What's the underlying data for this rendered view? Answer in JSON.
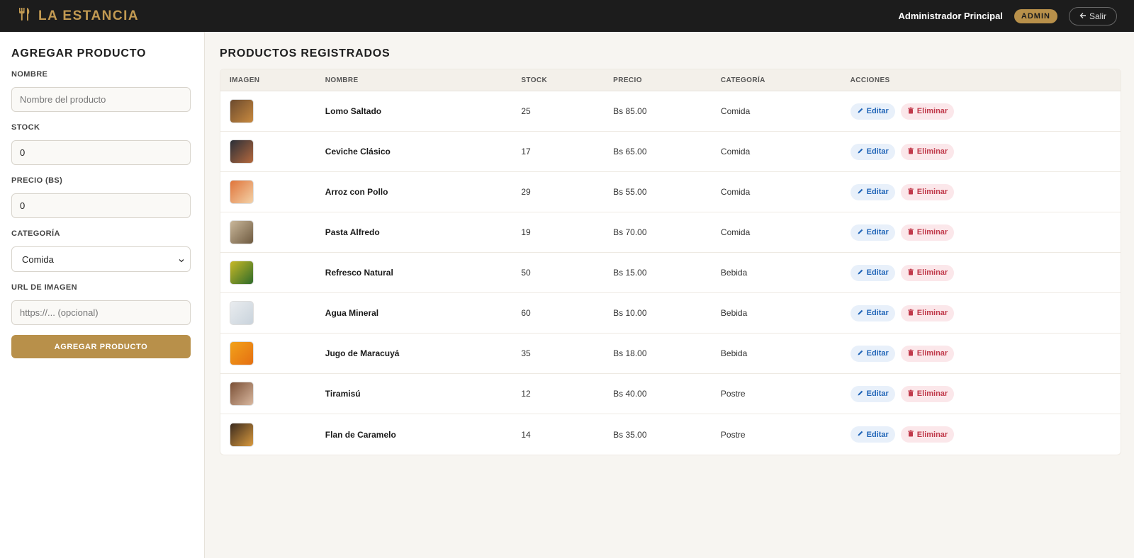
{
  "header": {
    "brand_icon": "utensils-icon",
    "brand": "LA ESTANCIA",
    "user": "Administrador Principal",
    "role": "ADMIN",
    "logout_icon": "arrow-left-icon",
    "logout": "Salir"
  },
  "form": {
    "title": "AGREGAR PRODUCTO",
    "name_label": "NOMBRE",
    "name_placeholder": "Nombre del producto",
    "stock_label": "STOCK",
    "stock_value": "0",
    "price_label": "PRECIO (BS)",
    "price_value": "0",
    "category_label": "CATEGORÍA",
    "category_value": "Comida",
    "image_label": "URL DE IMAGEN",
    "image_placeholder": "https://... (opcional)",
    "submit": "AGREGAR PRODUCTO"
  },
  "products": {
    "title": "PRODUCTOS REGISTRADOS",
    "columns": [
      "IMAGEN",
      "NOMBRE",
      "STOCK",
      "PRECIO",
      "CATEGORÍA",
      "ACCIONES"
    ],
    "edit_label": "Editar",
    "delete_label": "Eliminar",
    "rows": [
      {
        "name": "Lomo Saltado",
        "stock": "25",
        "price": "Bs 85.00",
        "category": "Comida",
        "thumb_colors": [
          "#6b4a2e",
          "#c98a3f"
        ]
      },
      {
        "name": "Ceviche Clásico",
        "stock": "17",
        "price": "Bs 65.00",
        "category": "Comida",
        "thumb_colors": [
          "#2a2f38",
          "#b5683d"
        ]
      },
      {
        "name": "Arroz con Pollo",
        "stock": "29",
        "price": "Bs 55.00",
        "category": "Comida",
        "thumb_colors": [
          "#e0743a",
          "#f3d2a8"
        ]
      },
      {
        "name": "Pasta Alfredo",
        "stock": "19",
        "price": "Bs 70.00",
        "category": "Comida",
        "thumb_colors": [
          "#c9b79a",
          "#6e5a40"
        ]
      },
      {
        "name": "Refresco Natural",
        "stock": "50",
        "price": "Bs 15.00",
        "category": "Bebida",
        "thumb_colors": [
          "#c7b826",
          "#2e6b2a"
        ]
      },
      {
        "name": "Agua Mineral",
        "stock": "60",
        "price": "Bs 10.00",
        "category": "Bebida",
        "thumb_colors": [
          "#e9ecef",
          "#c9d3dc"
        ]
      },
      {
        "name": "Jugo de Maracuyá",
        "stock": "35",
        "price": "Bs 18.00",
        "category": "Bebida",
        "thumb_colors": [
          "#f2a21a",
          "#e56f12"
        ]
      },
      {
        "name": "Tiramisú",
        "stock": "12",
        "price": "Bs 40.00",
        "category": "Postre",
        "thumb_colors": [
          "#7a4f35",
          "#d9b8a0"
        ]
      },
      {
        "name": "Flan de Caramelo",
        "stock": "14",
        "price": "Bs 35.00",
        "category": "Postre",
        "thumb_colors": [
          "#3a2a1e",
          "#d99a3e"
        ]
      }
    ]
  }
}
